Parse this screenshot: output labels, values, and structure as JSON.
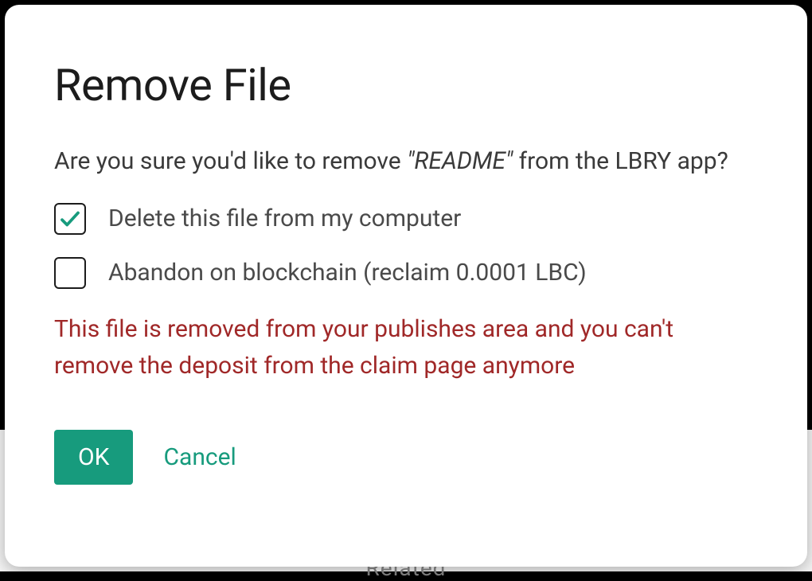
{
  "modal": {
    "title": "Remove File",
    "message_prefix": "Are you sure you'd like to remove ",
    "filename": "\"README\"",
    "message_suffix": " from the LBRY app?",
    "checkbox_delete": {
      "label": "Delete this file from my computer",
      "checked": true
    },
    "checkbox_abandon": {
      "label": "Abandon on blockchain (reclaim 0.0001 LBC)",
      "checked": false
    },
    "warning": "This file is removed from your publishes area and you can't remove the deposit from the claim page anymore",
    "ok_label": "OK",
    "cancel_label": "Cancel"
  },
  "backdrop": {
    "related_label": "Related"
  },
  "colors": {
    "accent": "#179b7d",
    "warning": "#a02828"
  }
}
